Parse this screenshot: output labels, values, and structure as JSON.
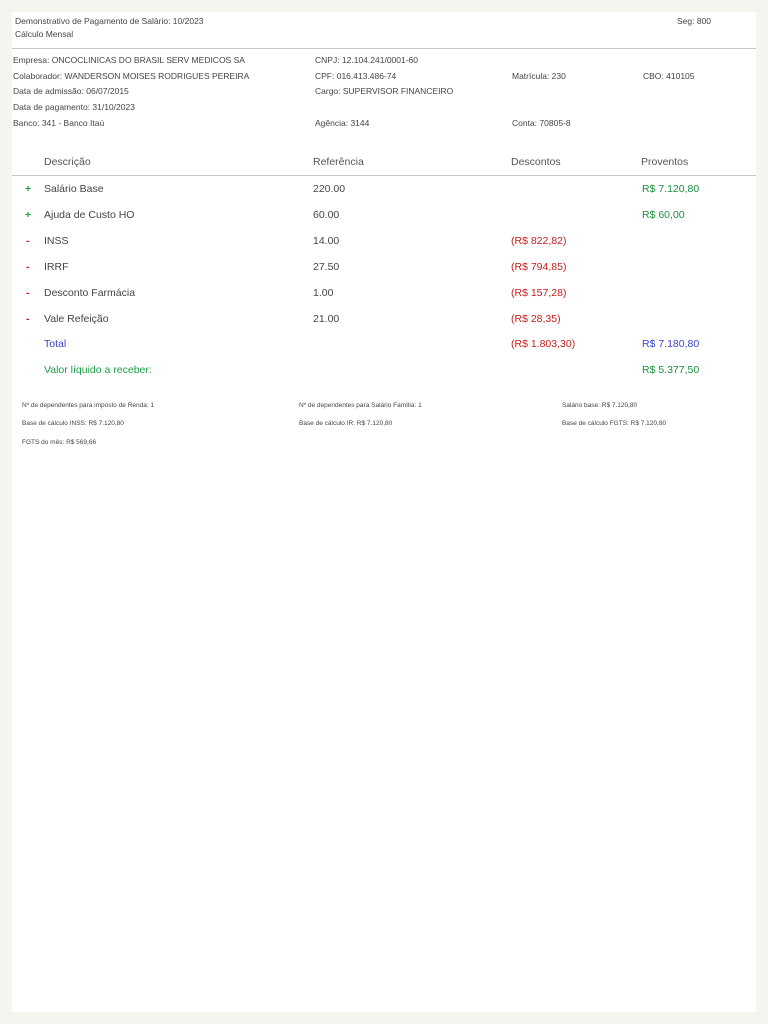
{
  "header": {
    "title": "Demonstrativo de Pagamento de Salário: 10/2023",
    "subtitle": "Cálculo Mensal",
    "seg": "Seg: 800"
  },
  "info": {
    "empresa": "Empresa: ONCOCLINICAS DO BRASIL SERV MEDICOS SA",
    "cnpj": "CNPJ: 12.104.241/0001-60",
    "colaborador": "Colaborador: WANDERSON MOISES RODRIGUES PEREIRA",
    "cpf": "CPF: 016.413.486-74",
    "matricula": "Matrícula: 230",
    "cbo": "CBO: 410105",
    "admissao": "Data de admissão: 06/07/2015",
    "cargo": "Cargo: SUPERVISOR FINANCEIRO",
    "pagamento": "Data de pagamento: 31/10/2023",
    "banco": "Banco: 341 - Banco Itaú",
    "agencia": "Agência: 3144",
    "conta": "Conta: 70805-8"
  },
  "table": {
    "headers": {
      "descricao": "Descrição",
      "referencia": "Referência",
      "descontos": "Descontos",
      "proventos": "Proventos"
    },
    "rows": [
      {
        "sign": "+",
        "descricao": "Salário Base",
        "referencia": "220.00",
        "descontos": "",
        "proventos": "R$ 7.120,80"
      },
      {
        "sign": "+",
        "descricao": "Ajuda de Custo HO",
        "referencia": "60.00",
        "descontos": "",
        "proventos": "R$ 60,00"
      },
      {
        "sign": "-",
        "descricao": "INSS",
        "referencia": "14.00",
        "descontos": "(R$ 822,82)",
        "proventos": ""
      },
      {
        "sign": "-",
        "descricao": "IRRF",
        "referencia": "27.50",
        "descontos": "(R$ 794,85)",
        "proventos": ""
      },
      {
        "sign": "-",
        "descricao": "Desconto Farmácia",
        "referencia": "1.00",
        "descontos": "(R$ 157,28)",
        "proventos": ""
      },
      {
        "sign": "-",
        "descricao": "Vale Refeição",
        "referencia": "21.00",
        "descontos": "(R$ 28,35)",
        "proventos": ""
      }
    ],
    "total": {
      "label": "Total",
      "descontos": "(R$ 1.803,30)",
      "proventos": "R$ 7.180,80"
    },
    "liquido": {
      "label": "Valor líquido a receber:",
      "value": "R$ 5.377,50"
    }
  },
  "footer": {
    "dep_ir": "Nº de dependentes para imposto de Renda: 1",
    "dep_sf": "Nº de dependentes para Salário Família: 1",
    "salario_base": "Salário base: R$ 7.120,80",
    "base_inss": "Base de cálculo INSS: R$ 7.120,80",
    "base_ir": "Base de cálculo IR: R$ 7.120,80",
    "base_fgts": "Base de cálculo FGTS: R$ 7.120,80",
    "fgts_mes": "FGTS do mês: R$ 569,66"
  }
}
